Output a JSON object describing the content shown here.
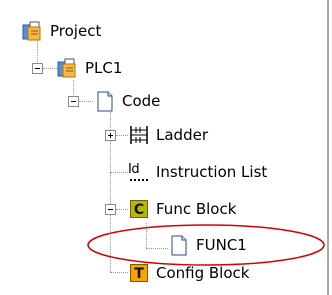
{
  "tree": {
    "project_label": "Project",
    "plc_label": "PLC1",
    "code_label": "Code",
    "ladder_label": "Ladder",
    "instruction_list_label": "Instruction List",
    "instruction_list_icon_text": "Id",
    "func_block_label": "Func Block",
    "func_block_icon_letter": "C",
    "func1_label": "FUNC1",
    "config_block_label": "Config Block",
    "config_block_icon_letter": "T"
  },
  "colors": {
    "func_block_icon_bg": "#b5b800",
    "config_block_icon_bg": "#f7a400",
    "highlight_ellipse": "#d60000",
    "tree_lines": "#9a9a9a"
  },
  "icons": {
    "project": "project-icon",
    "plc": "plc-icon",
    "code": "document-icon",
    "ladder": "ladder-icon",
    "instruction_list": "instruction-list-icon",
    "func_block": "c-letter-icon",
    "func1": "document-icon",
    "config_block": "t-letter-icon"
  }
}
